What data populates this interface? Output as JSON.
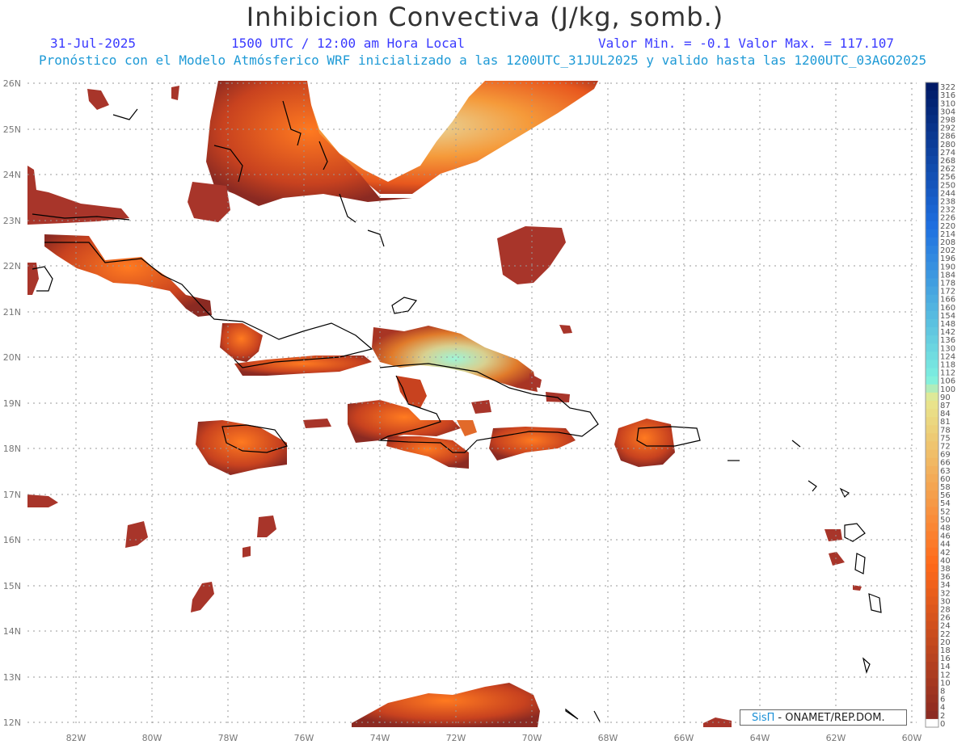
{
  "header": {
    "title": "Inhibicion Convectiva (J/kg, somb.)",
    "date": "31-Jul-2025",
    "time": "1500 UTC / 12:00 am Hora Local",
    "min_max": "Valor Min. = -0.1  Valor Max. = 117.107",
    "forecast": "Pronóstico con el Modelo Atmósferico WRF inicializado a las 1200UTC_31JUL2025 y valido hasta las  1200UTC_03AGO2025"
  },
  "map": {
    "lat_labels": [
      "26N",
      "25N",
      "24N",
      "23N",
      "22N",
      "21N",
      "20N",
      "19N",
      "18N",
      "17N",
      "16N",
      "15N",
      "14N",
      "13N",
      "12N"
    ],
    "lon_labels": [
      "82W",
      "80W",
      "78W",
      "76W",
      "74W",
      "72W",
      "70W",
      "68W",
      "66W",
      "64W",
      "62W",
      "60W"
    ]
  },
  "legend": {
    "labels": [
      "322",
      "316",
      "310",
      "304",
      "298",
      "292",
      "286",
      "280",
      "274",
      "268",
      "262",
      "256",
      "250",
      "244",
      "238",
      "232",
      "226",
      "220",
      "214",
      "208",
      "202",
      "196",
      "190",
      "184",
      "178",
      "172",
      "166",
      "160",
      "154",
      "148",
      "142",
      "136",
      "130",
      "124",
      "118",
      "112",
      "106",
      "100",
      "90",
      "87",
      "84",
      "81",
      "78",
      "75",
      "72",
      "69",
      "66",
      "63",
      "60",
      "58",
      "56",
      "54",
      "52",
      "50",
      "48",
      "46",
      "44",
      "42",
      "40",
      "38",
      "36",
      "34",
      "32",
      "30",
      "28",
      "26",
      "24",
      "22",
      "20",
      "18",
      "16",
      "14",
      "12",
      "10",
      "8",
      "6",
      "4",
      "2",
      "0"
    ],
    "colors": {
      "top": "#001a66",
      "blue": "#1e6fe0",
      "cyan": "#7ff0e0",
      "yellow": "#e8e890",
      "orange": "#ff6a1a",
      "red": "#8b2a22"
    }
  },
  "credit": {
    "brand": "SisΠ",
    "text": "- ONAMET/REP.DOM."
  }
}
